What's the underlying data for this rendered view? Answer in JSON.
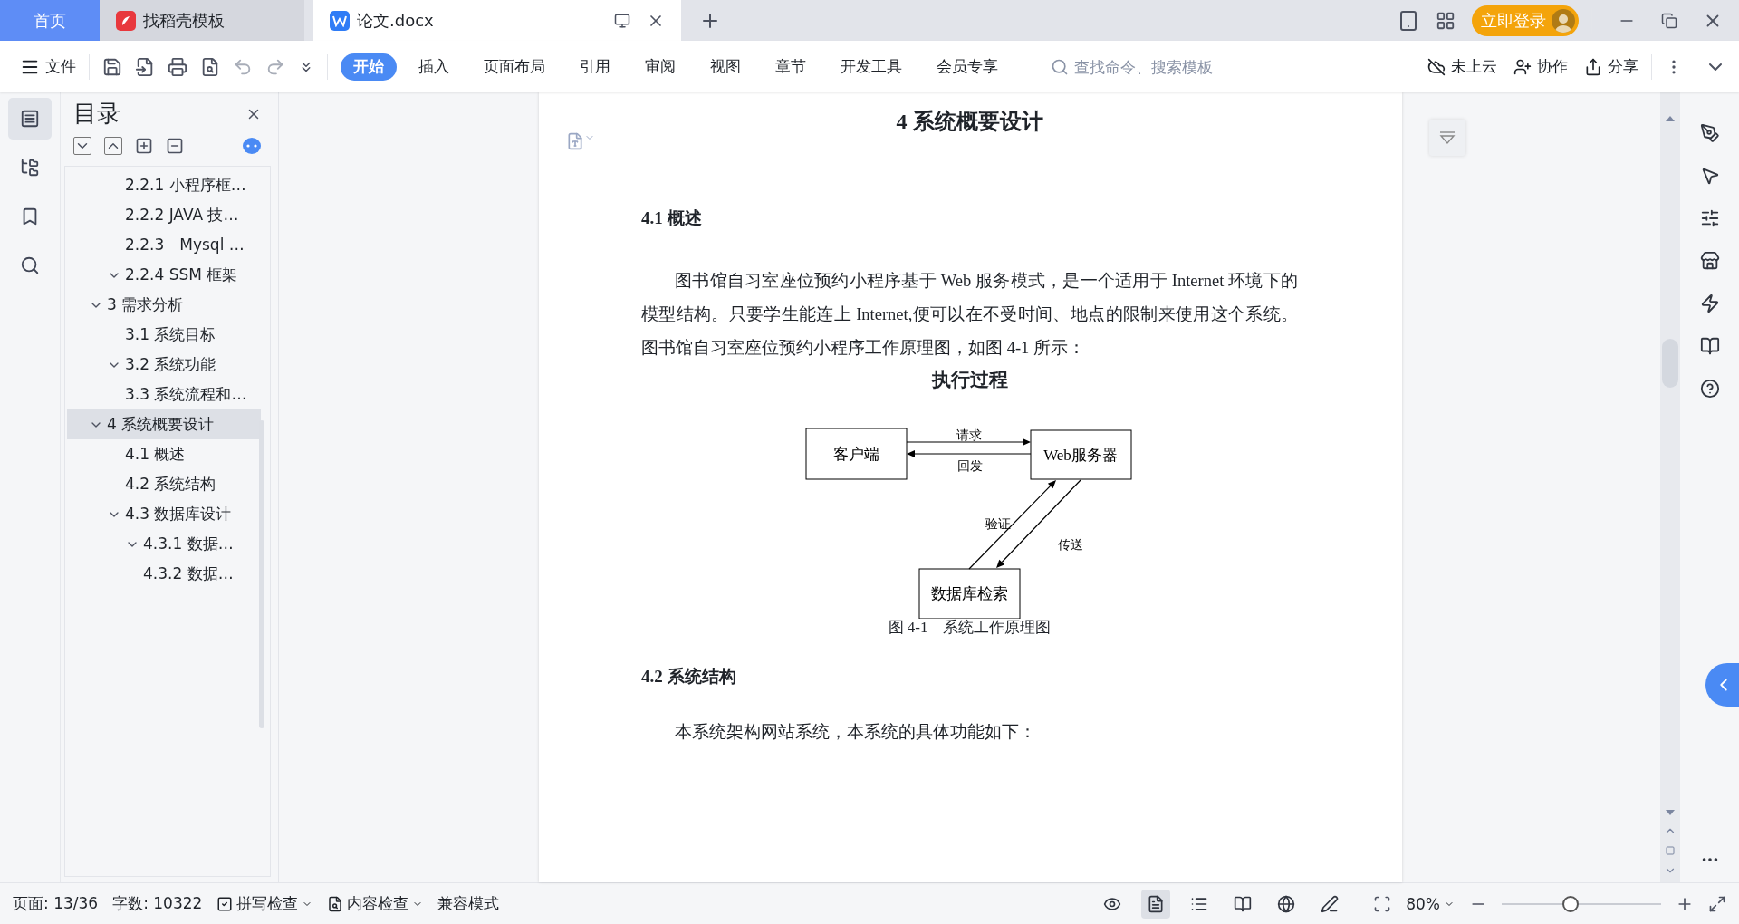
{
  "window_tabs": [
    {
      "label": "首页",
      "kind": "home",
      "selected": false
    },
    {
      "label": "找稻壳模板",
      "kind": "template",
      "selected": false
    },
    {
      "label": "论文.docx",
      "kind": "doc",
      "selected": true
    }
  ],
  "account": {
    "login": "立即登录"
  },
  "toolbar": {
    "file": "文件",
    "ribbon_tabs": [
      {
        "label": "开始",
        "selected": true
      },
      {
        "label": "插入",
        "selected": false
      },
      {
        "label": "页面布局",
        "selected": false
      },
      {
        "label": "引用",
        "selected": false
      },
      {
        "label": "审阅",
        "selected": false
      },
      {
        "label": "视图",
        "selected": false
      },
      {
        "label": "章节",
        "selected": false
      },
      {
        "label": "开发工具",
        "selected": false
      },
      {
        "label": "会员专享",
        "selected": false
      }
    ],
    "search": {
      "placeholder": "查找命令、搜索模板"
    },
    "actions": [
      {
        "label": "未上云",
        "kind": "cloud"
      },
      {
        "label": "协作",
        "kind": "share-user"
      },
      {
        "label": "分享",
        "kind": "share"
      }
    ]
  },
  "left_rail": [
    {
      "kind": "toc",
      "selected": true
    },
    {
      "kind": "nav",
      "selected": false
    },
    {
      "kind": "bookmark",
      "selected": false
    },
    {
      "kind": "search",
      "selected": false
    }
  ],
  "toc": {
    "title": "目录",
    "items": [
      {
        "children": [
          {
            "label": "2.2.1 小程序框…",
            "selected": false
          },
          {
            "label": "2.2.2 JAVA 技…",
            "selected": false
          },
          {
            "label": "2.2.3　Mysql …",
            "selected": false
          },
          {
            "label": "2.2.4 SSM 框架",
            "selected": false,
            "expanded": true
          }
        ]
      },
      {
        "label": "3  需求分析",
        "selected": false,
        "expanded": true,
        "children": [
          {
            "label": "3.1 系统目标",
            "selected": false
          },
          {
            "label": "3.2 系统功能",
            "selected": false,
            "expanded": true
          },
          {
            "label": "3.3 系统流程和…",
            "selected": false
          }
        ]
      },
      {
        "label": "4 系统概要设计",
        "selected": true,
        "expanded": true,
        "children": [
          {
            "label": "4.1  概述",
            "selected": false
          },
          {
            "label": "4.2  系统结构",
            "selected": false
          },
          {
            "label": "4.3 数据库设计",
            "selected": false,
            "expanded": true,
            "children": [
              {
                "label": "4.3.1  数据…",
                "selected": false,
                "expanded": true
              },
              {
                "label": "4.3.2  数据…",
                "selected": false
              }
            ]
          }
        ]
      }
    ]
  },
  "document": {
    "title": "4 系统概要设计",
    "section_1": "4.1  概述",
    "paragraph_1": "图书馆自习室座位预约小程序基于 Web 服务模式，是一个适用于 Internet 环境下的模型结构。只要学生能连上 Internet,便可以在不受时间、地点的限制来使用这个系统。图书馆自习室座位预约小程序工作原理图，如图 4-1 所示：",
    "figure_title": "执行过程",
    "diagram": {
      "client": "客户端",
      "server": "Web服务器",
      "database": "数据库检索",
      "request": "请求",
      "reply": "回发",
      "verify": "验证",
      "transfer": "传送"
    },
    "caption": "图 4-1　系统工作原理图",
    "section_2": "4.2  系统结构",
    "paragraph_2": "本系统架构网站系统，本系统的具体功能如下："
  },
  "status_bar": {
    "page": "页面: 13/36",
    "words": "字数: 10322",
    "spell": "拼写检查",
    "content": "内容检查",
    "compat": "兼容模式",
    "views": [
      {
        "kind": "eye",
        "selected": false
      },
      {
        "kind": "page",
        "selected": true
      },
      {
        "kind": "outline",
        "selected": false
      },
      {
        "kind": "read",
        "selected": false
      },
      {
        "kind": "web",
        "selected": false
      },
      {
        "kind": "pen",
        "selected": false
      }
    ],
    "zoom": "80%",
    "zoom_slider": {
      "level": 0.43
    }
  }
}
